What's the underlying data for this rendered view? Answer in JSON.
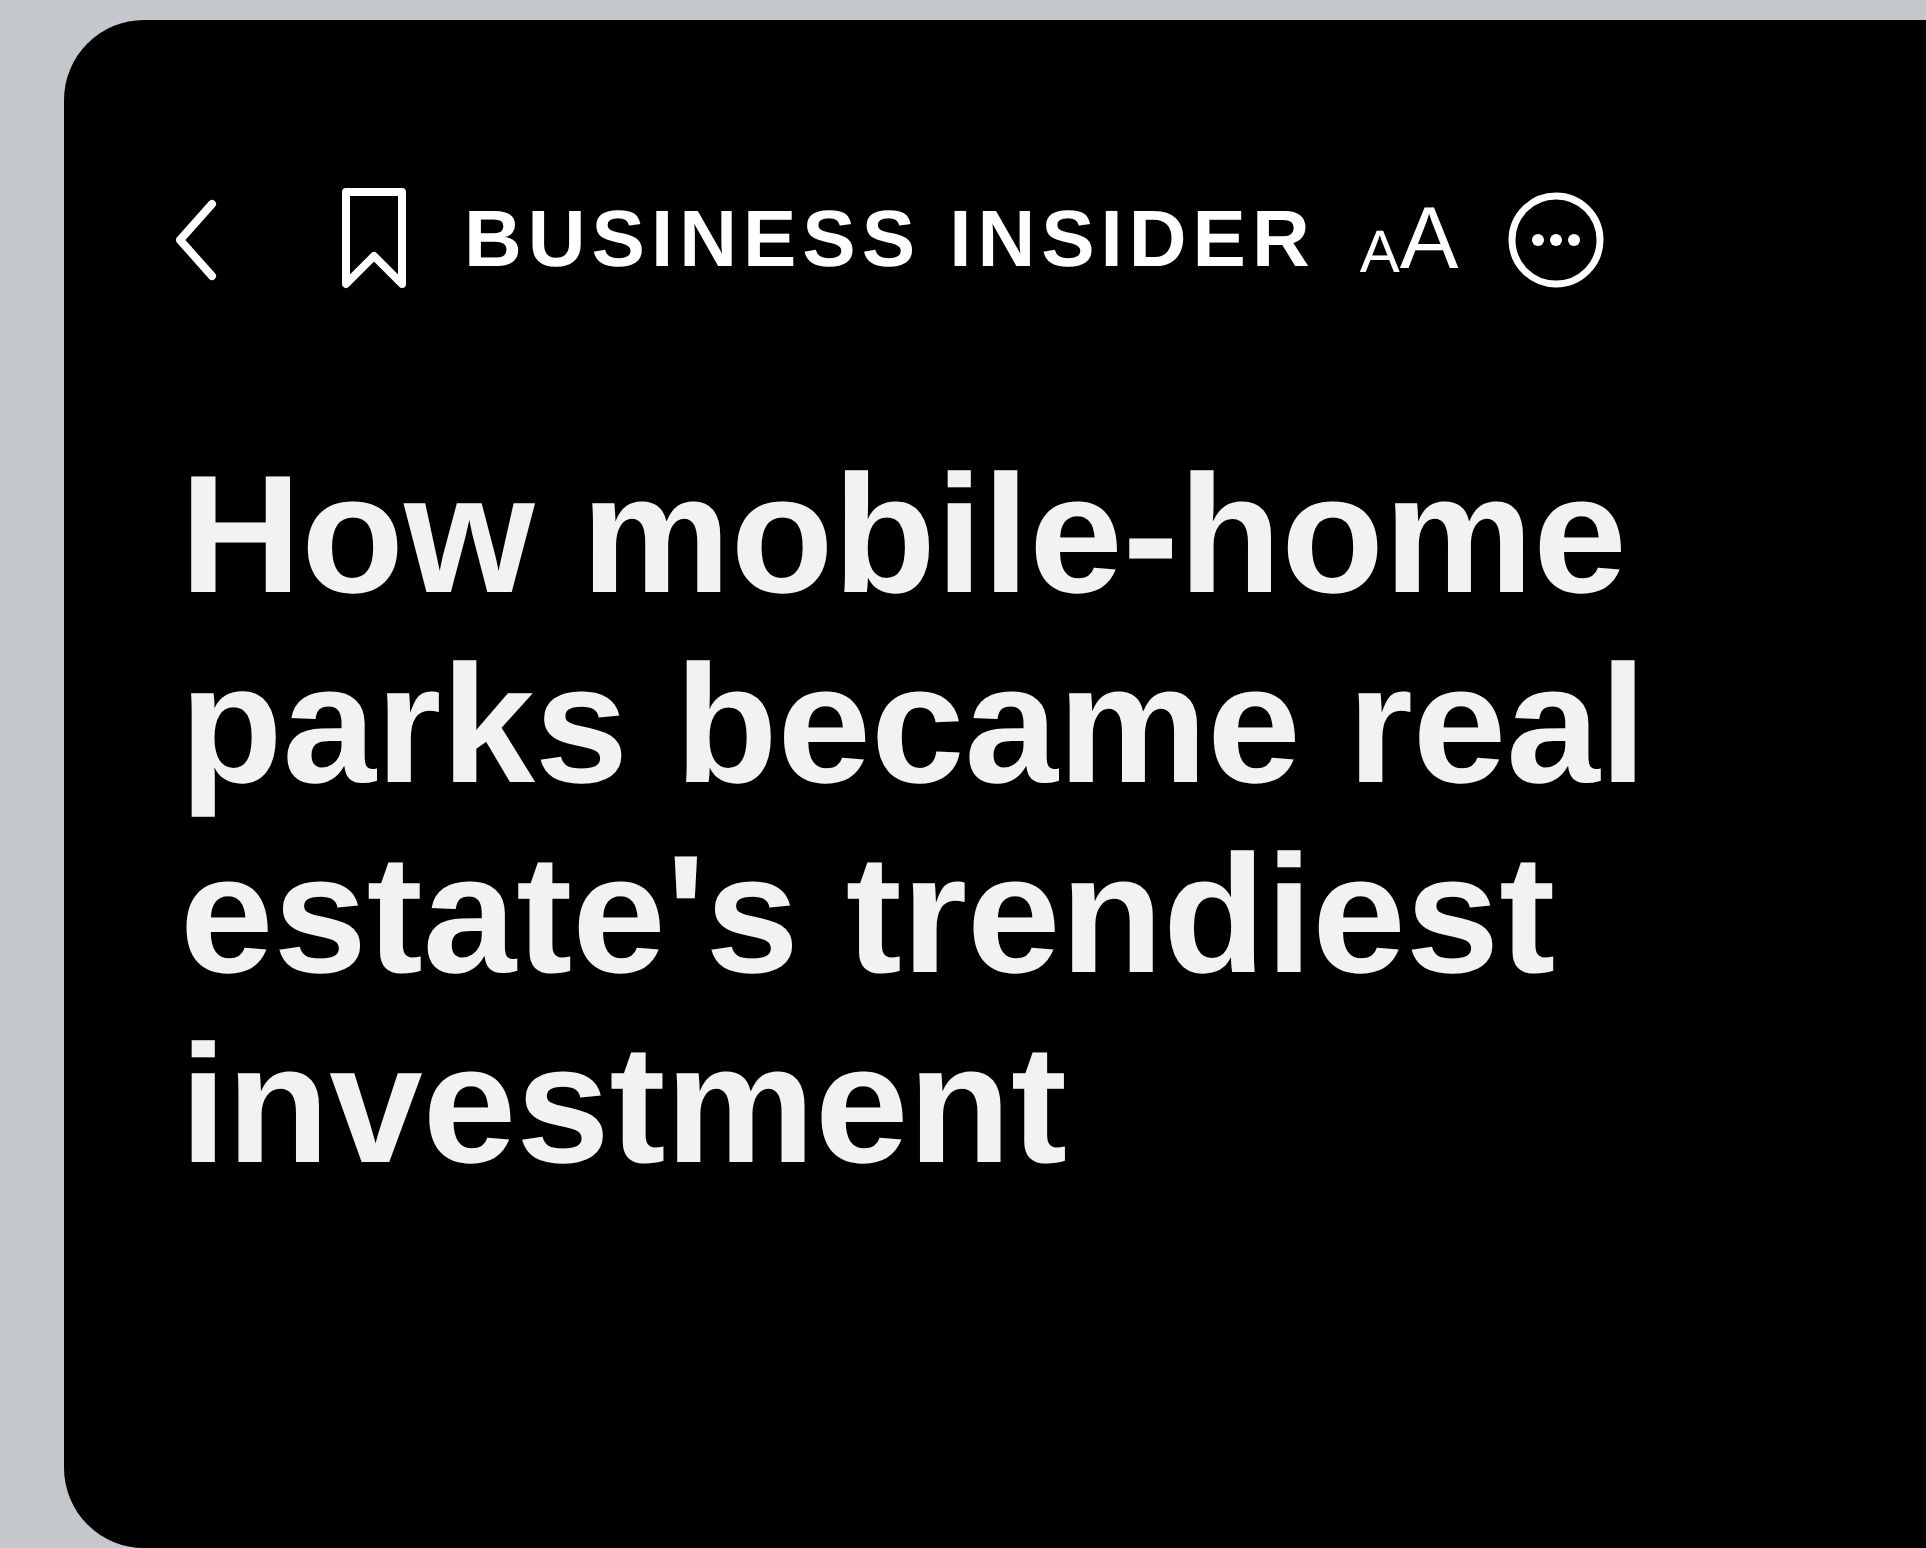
{
  "toolbar": {
    "logo": "BUSINESS INSIDER",
    "text_size_button": "AA"
  },
  "article": {
    "headline": "How mobile-home parks became real estate's trendiest investment"
  }
}
